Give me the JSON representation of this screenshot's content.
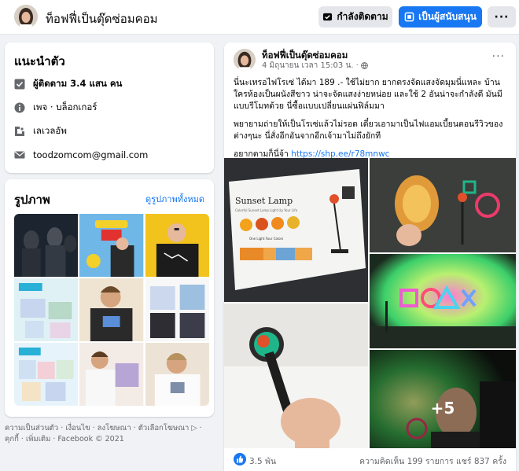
{
  "header": {
    "page_name": "ท็อฟฟี่เป็นตุ๊ดซ่อมคอม",
    "following_label": "กำลังติดตาม",
    "support_label": "เป็นผู้สนับสนุน",
    "more_label": "···"
  },
  "intro": {
    "title": "แนะนำตัว",
    "rows": [
      {
        "icon": "followers-icon",
        "text": "ผู้ติดตาม 3.4 แสน คน"
      },
      {
        "icon": "info-icon",
        "text": "เพจ · บล็อกเกอร์"
      },
      {
        "icon": "level-up-icon",
        "text": "เลเวลอัพ"
      },
      {
        "icon": "email-icon",
        "text": "toodzomcom@gmail.com"
      }
    ]
  },
  "photos": {
    "title": "รูปภาพ",
    "see_all": "ดูรูปภาพทั้งหมด"
  },
  "footer": {
    "text": "ความเป็นส่วนตัว · เงื่อนไข · ลงโฆษณา · ตัวเลือกโฆษณา ▷ · คุกกี้ · เพิ่มเติม · Facebook © 2021"
  },
  "post": {
    "author": "ท็อฟฟี่เป็นตุ๊ดซ่อมคอม",
    "time": "4 มิถุนายน เวลา 15:03 น. ·",
    "paragraphs": [
      "นี่นะเทรอไฟโรเซ่ ได้มา 189 .- ใช้ไม่ยาก ยากตรงจัดแสงจัดมุมนี่แหละ บ้าน ใครห้องเป็นผนังสีขาว น่าจะจัดแสงง่ายหน่อย และใช้ 2 อันน่าจะกำลังดี มันมี แบบรีโมทด้วย นี่ซื้อแบบเปลี่ยนแผ่นฟิล์มมา",
      "พยายามถ่ายให้เป็นโรเซ่แล้วไม่รอด เดี๋ยวเอามาเป็นไฟแอมเบี้ยนตอนรีวิวของ ต่างๆนะ นี่สั่งอีกอันจากอีกเจ้ามาไม่ถึงยักที"
    ],
    "link_prefix": "อยากตามก็นี่จ้า ",
    "link": "https://shp.ee/r78mnwc",
    "more_photos": "+5",
    "likes": "3.5 พัน",
    "stats": "ความคิดเห็น 199 รายการ  แชร์ 837 ครั้ง"
  },
  "product_box": {
    "title": "Sunset Lamp",
    "subtitle": "Colorful Sunset Lamp Light Up Your Life",
    "caption": "One Light Four Colors"
  },
  "colors": {
    "accent": "#1877f2",
    "bg": "#f0f2f5",
    "text_secondary": "#65676b"
  }
}
